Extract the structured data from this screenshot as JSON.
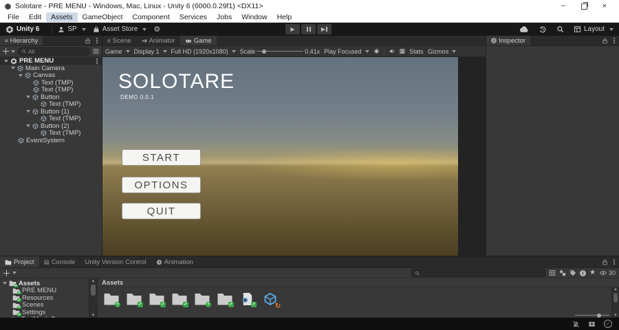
{
  "window": {
    "title": "Solotare - PRE MENU - Windows, Mac, Linux - Unity 6 (6000.0.29f1) <DX11>"
  },
  "menu": {
    "items": [
      "File",
      "Edit",
      "Assets",
      "GameObject",
      "Component",
      "Services",
      "Jobs",
      "Window",
      "Help"
    ],
    "highlighted": "Assets"
  },
  "topbar": {
    "unity_version": "Unity 6",
    "account": "SP",
    "asset_store": "Asset Store",
    "layout": "Layout"
  },
  "hierarchy": {
    "tab": "Hierarchy",
    "search_value": "All",
    "scene": "PRE MENU",
    "items": [
      {
        "label": "Main Camera"
      },
      {
        "label": "Canvas"
      },
      {
        "label": "Text (TMP)"
      },
      {
        "label": "Text (TMP)"
      },
      {
        "label": "Button"
      },
      {
        "label": "Text (TMP)"
      },
      {
        "label": "Button (1)"
      },
      {
        "label": "Text (TMP)"
      },
      {
        "label": "Button (2)"
      },
      {
        "label": "Text (TMP)"
      },
      {
        "label": "EventSystem"
      }
    ]
  },
  "view_tabs": {
    "scene": "Scene",
    "animator": "Animator",
    "game": "Game"
  },
  "game_toolbar": {
    "mode": "Game",
    "display": "Display 1",
    "resolution": "Full HD (1920x1080)",
    "scale_label": "Scale",
    "scale_value": "0.41x",
    "focus_mode": "Play Focused",
    "stats": "Stats",
    "gizmos": "Gizmos"
  },
  "game_view": {
    "title": "SOLOTARE",
    "subtitle": "DEMO 0.0.1",
    "buttons": [
      "START",
      "OPTIONS",
      "QUIT"
    ]
  },
  "inspector": {
    "tab": "Inspector"
  },
  "bottom_panel": {
    "tabs": [
      "Project",
      "Console",
      "Unity Version Control",
      "Animation"
    ],
    "active_tab": "Project",
    "eye_count": "30"
  },
  "project": {
    "root": {
      "label": "Assets"
    },
    "folders": [
      {
        "label": "PRE MENU"
      },
      {
        "label": "Resources"
      },
      {
        "label": "Scenes"
      },
      {
        "label": "Settings"
      },
      {
        "label": "TextMesh Pro"
      }
    ],
    "pane_header": "Assets"
  },
  "icons": {
    "gear": "⚙",
    "cloud": "☁",
    "history": "↺",
    "star": "★",
    "console": "▤",
    "scene_grid": "#",
    "frame_grid": "▦",
    "check": "✓",
    "plus": "+",
    "warning": "!",
    "close": "×",
    "minimize": "−",
    "refresh": "↻",
    "info": "i"
  },
  "colors": {
    "badge_green": "#35a845",
    "package_blue": "#58a6e0",
    "badge_orange": "#e8732a"
  }
}
